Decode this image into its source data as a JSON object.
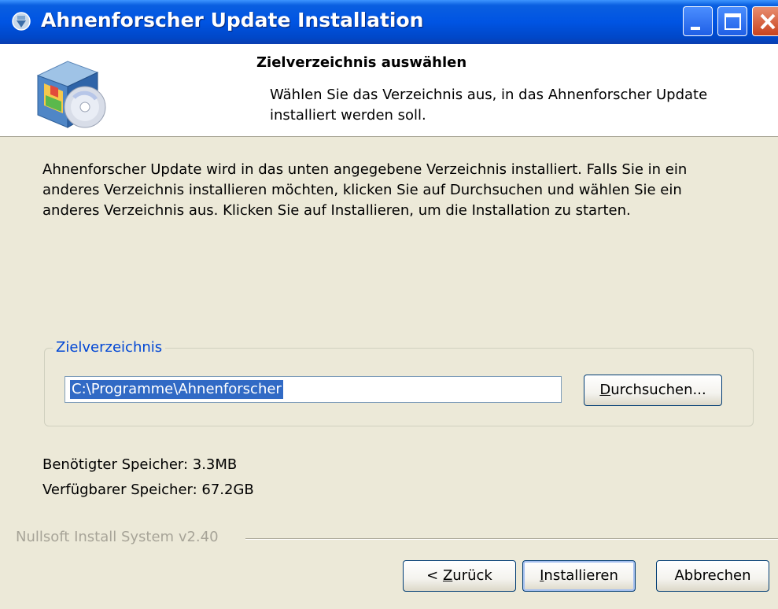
{
  "window": {
    "title": "Ahnenforscher Update Installation",
    "icon": "installer-app-icon"
  },
  "header": {
    "title": "Zielverzeichnis auswählen",
    "subtitle": "Wählen Sie das Verzeichnis aus, in das Ahnenforscher Update installiert werden soll."
  },
  "body": {
    "intro": "Ahnenforscher Update wird in das unten angegebene Verzeichnis installiert. Falls Sie in ein anderes Verzeichnis installieren möchten, klicken Sie auf Durchsuchen und wählen Sie ein anderes Verzeichnis aus. Klicken Sie auf Installieren, um die Installation zu starten."
  },
  "destination": {
    "legend": "Zielverzeichnis",
    "path": "C:\\Programme\\Ahnenforscher",
    "browse_pre": "",
    "browse_u": "D",
    "browse_post": "urchsuchen..."
  },
  "space": {
    "required": "Benötigter Speicher: 3.3MB",
    "available": "Verfügbarer Speicher: 67.2GB"
  },
  "branding": "Nullsoft Install System v2.40",
  "buttons": {
    "back_pre": "< ",
    "back_u": "Z",
    "back_post": "urück",
    "install_u": "I",
    "install_post": "nstallieren",
    "cancel": "Abbrechen"
  },
  "colors": {
    "titlebar": "#0054e3",
    "dialog_bg": "#ece9d8",
    "selection": "#316ac5",
    "legend": "#0046d5"
  }
}
